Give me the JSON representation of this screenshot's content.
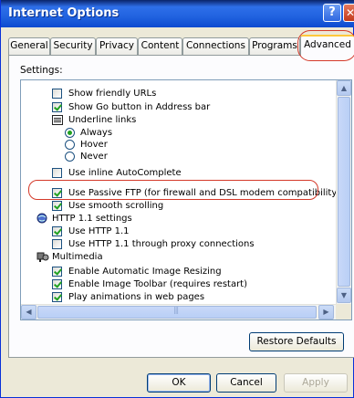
{
  "window": {
    "title": "Internet Options",
    "help_label": "?",
    "close_label": "✕"
  },
  "tabs": [
    {
      "label": "General"
    },
    {
      "label": "Security"
    },
    {
      "label": "Privacy"
    },
    {
      "label": "Content"
    },
    {
      "label": "Connections"
    },
    {
      "label": "Programs"
    },
    {
      "label": "Advanced"
    }
  ],
  "panel": {
    "settings_label": "Settings:",
    "items": [
      {
        "type": "checkbox",
        "checked": false,
        "label": "Show friendly URLs"
      },
      {
        "type": "checkbox",
        "checked": true,
        "label": "Show Go button in Address bar"
      },
      {
        "type": "checkbox-group",
        "label": "Underline links"
      },
      {
        "type": "radio",
        "checked": true,
        "label": "Always"
      },
      {
        "type": "radio",
        "checked": false,
        "label": "Hover"
      },
      {
        "type": "radio",
        "checked": false,
        "label": "Never"
      },
      {
        "type": "checkbox",
        "checked": false,
        "label": "Use inline AutoComplete"
      },
      {
        "type": "checkbox",
        "checked": true,
        "label": "Use Passive FTP (for firewall and DSL modem compatibility)"
      },
      {
        "type": "checkbox",
        "checked": true,
        "label": "Use smooth scrolling"
      },
      {
        "type": "category",
        "icon": "globe-icon",
        "label": "HTTP 1.1 settings"
      },
      {
        "type": "checkbox",
        "checked": true,
        "label": "Use HTTP 1.1"
      },
      {
        "type": "checkbox",
        "checked": false,
        "label": "Use HTTP 1.1 through proxy connections"
      },
      {
        "type": "category",
        "icon": "multimedia-icon",
        "label": "Multimedia"
      },
      {
        "type": "checkbox",
        "checked": true,
        "label": "Enable Automatic Image Resizing"
      },
      {
        "type": "checkbox",
        "checked": true,
        "label": "Enable Image Toolbar (requires restart)"
      },
      {
        "type": "checkbox",
        "checked": true,
        "label": "Play animations in web pages"
      }
    ],
    "restore_defaults_label": "Restore Defaults"
  },
  "footer": {
    "ok_label": "OK",
    "cancel_label": "Cancel",
    "apply_label": "Apply"
  },
  "colors": {
    "highlight_ring": "#d43a2a",
    "titlebar": "#2163e0",
    "check": "#21a121"
  }
}
